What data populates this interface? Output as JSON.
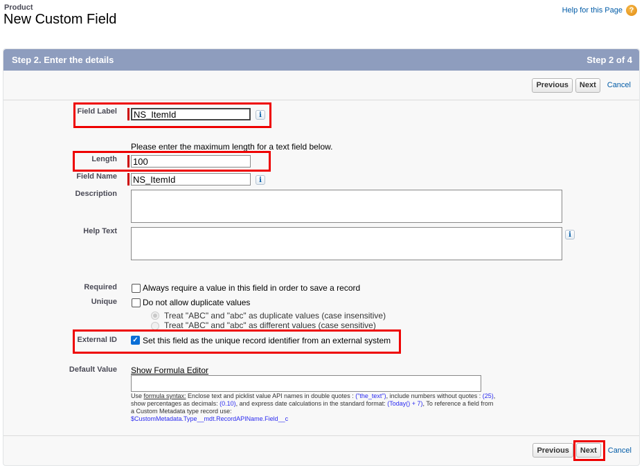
{
  "header": {
    "object_name": "Product",
    "title": "New Custom Field",
    "help_link": "Help for this Page",
    "help_icon": "question-circle-icon"
  },
  "step_bar": {
    "title": "Step 2. Enter the details",
    "step_indicator": "Step 2 of 4"
  },
  "buttons": {
    "previous": "Previous",
    "next": "Next",
    "cancel": "Cancel"
  },
  "form": {
    "field_label": {
      "label": "Field Label",
      "value": "NS_ItemId"
    },
    "length_note": "Please enter the maximum length for a text field below.",
    "length": {
      "label": "Length",
      "value": "100"
    },
    "field_name": {
      "label": "Field Name",
      "value": "NS_ItemId"
    },
    "description": {
      "label": "Description",
      "value": ""
    },
    "help_text": {
      "label": "Help Text",
      "value": ""
    },
    "required": {
      "label": "Required",
      "text": "Always require a value in this field in order to save a record",
      "checked": false
    },
    "unique": {
      "label": "Unique",
      "text": "Do not allow duplicate values",
      "checked": false,
      "options": [
        {
          "text": "Treat \"ABC\" and \"abc\" as duplicate values (case insensitive)",
          "selected": true,
          "disabled": true
        },
        {
          "text": "Treat \"ABC\" and \"abc\" as different values (case sensitive)",
          "selected": false,
          "disabled": true
        }
      ]
    },
    "external_id": {
      "label": "External ID",
      "text": "Set this field as the unique record identifier from an external system",
      "checked": true
    },
    "default_value": {
      "label": "Default Value",
      "formula_link": "Show Formula Editor",
      "value": "",
      "hint": {
        "use": "Use ",
        "syntax_link": "formula syntax:",
        "p1": " Enclose text and picklist value API names in double quotes : ",
        "c1": "(\"the_text\")",
        "p2": ", include numbers without quotes : ",
        "c2": "(25)",
        "p3": ", show percentages as decimals: ",
        "c3": "(0.10)",
        "p4": ", and express date calculations in the standard format: ",
        "c4": "(Today() + 7)",
        "p5": ", To reference a field from a Custom Metadata type record use: ",
        "c5": "$CustomMetadata.Type__mdt.RecordAPIName.Field__c"
      }
    }
  }
}
